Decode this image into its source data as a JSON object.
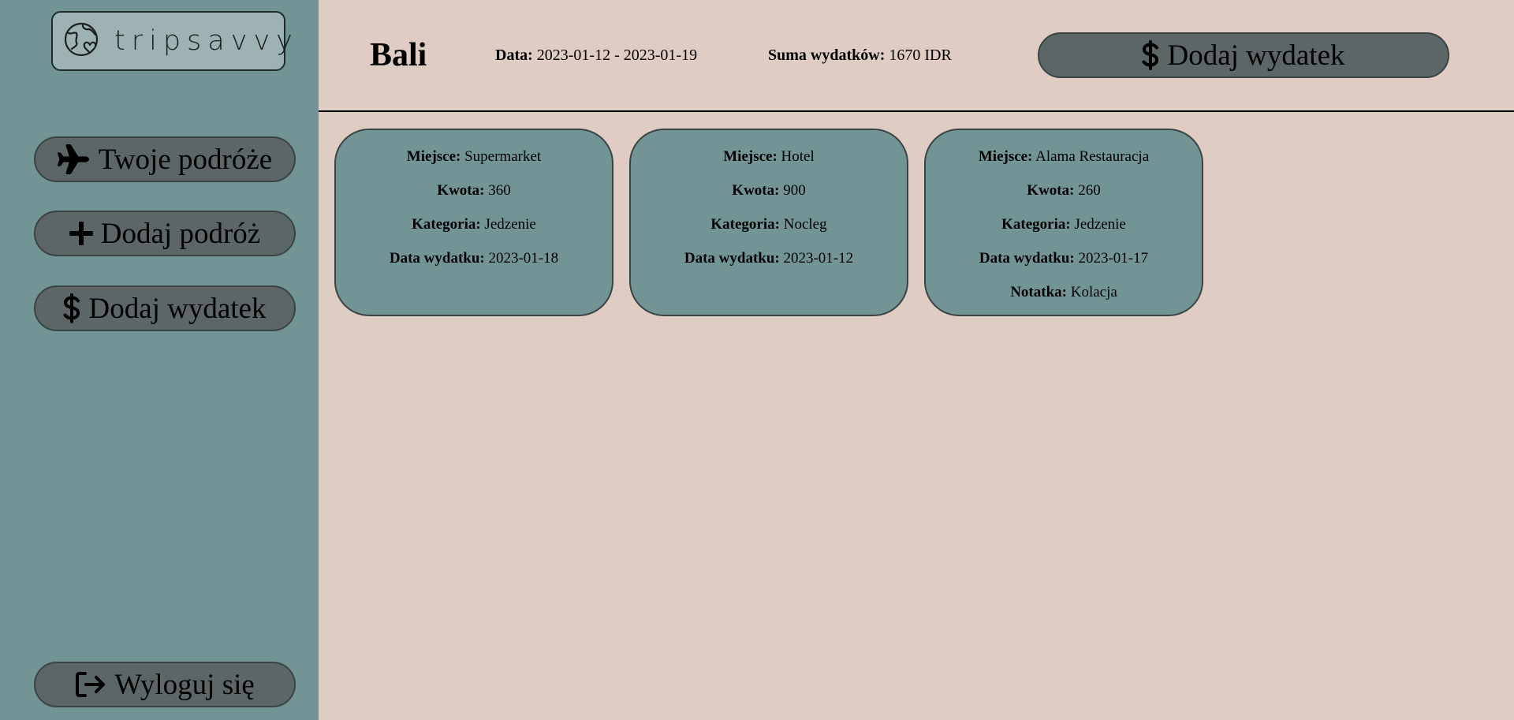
{
  "sidebar": {
    "logo_text": "tripsavvy",
    "items": [
      {
        "label": "Twoje podróże",
        "icon": "plane-icon"
      },
      {
        "label": "Dodaj podróż",
        "icon": "plus-icon"
      },
      {
        "label": "Dodaj wydatek",
        "icon": "dollar-icon"
      }
    ],
    "logout_label": "Wyloguj się",
    "logout_icon": "logout-icon"
  },
  "header": {
    "title": "Bali",
    "dates_label": "Data:",
    "dates_value": "2023-01-12 - 2023-01-19",
    "sum_label": "Suma wydatków:",
    "sum_value": "1670 IDR",
    "add_expense_label": "Dodaj wydatek"
  },
  "labels": {
    "place": "Miejsce:",
    "amount": "Kwota:",
    "category": "Kategoria:",
    "date": "Data wydatku:",
    "note": "Notatka:"
  },
  "expenses": [
    {
      "place": "Supermarket",
      "amount": "360",
      "category": "Jedzenie",
      "date": "2023-01-18"
    },
    {
      "place": "Hotel",
      "amount": "900",
      "category": "Nocleg",
      "date": "2023-01-12"
    },
    {
      "place": "Alama Restauracja",
      "amount": "260",
      "category": "Jedzenie",
      "date": "2023-01-17",
      "note": "Kolacja"
    }
  ],
  "colors": {
    "sidebar_bg": "#729495",
    "page_bg": "#dfcdc4",
    "button_bg": "#5d6667",
    "card_bg": "#729495",
    "logo_bg": "#9fb2b3"
  }
}
